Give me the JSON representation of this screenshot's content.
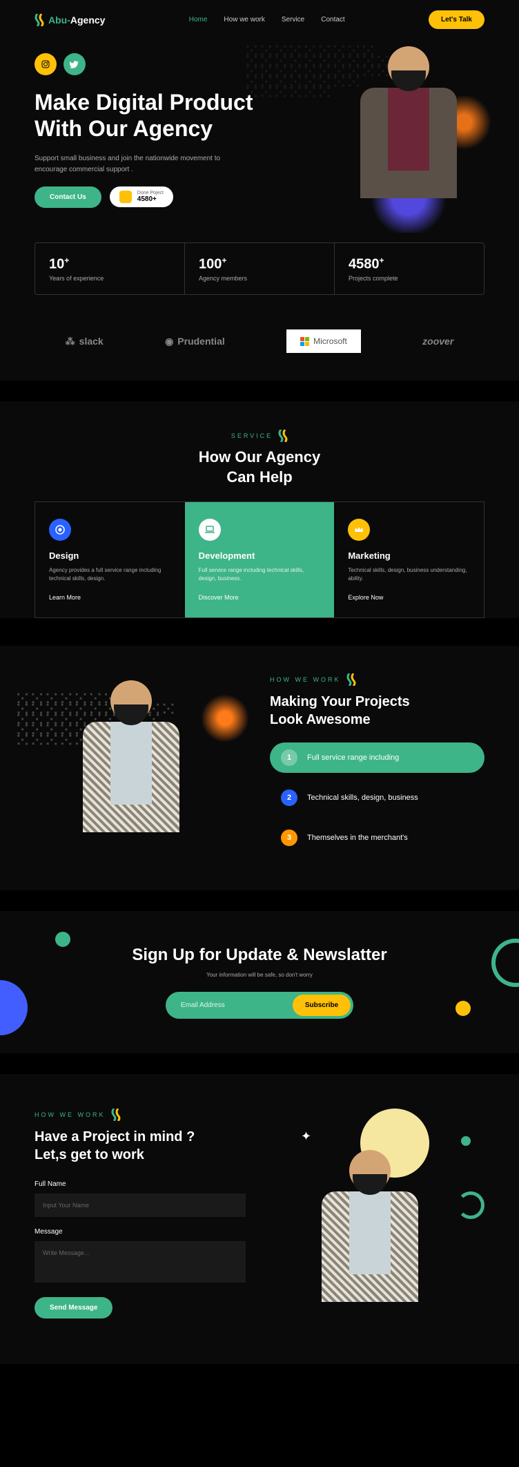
{
  "brand": {
    "abu": "Abu-",
    "agency": "Agency"
  },
  "nav": {
    "home": "Home",
    "how": "How we work",
    "service": "Service",
    "contact": "Contact"
  },
  "cta": "Let's Talk",
  "hero": {
    "title1": "Make Digital Product",
    "title2": "With Our Agency",
    "text": "Support small business and join the nationwide movement to encourage commercial support .",
    "contact": "Contact Us",
    "done_label": "Done Poject",
    "done_num": "4580+"
  },
  "stats": [
    {
      "num": "10",
      "plus": "+",
      "label": "Years of experience"
    },
    {
      "num": "100",
      "plus": "+",
      "label": "Agency members"
    },
    {
      "num": "4580",
      "plus": "+",
      "label": "Projects complete"
    }
  ],
  "logos": {
    "slack": "slack",
    "prudential": "Prudential",
    "microsoft": "Microsoft",
    "zoover": "zoover"
  },
  "services": {
    "label": "SERVICE",
    "title1": "How Our Agency",
    "title2": "Can Help",
    "cards": [
      {
        "name": "Design",
        "desc": "Agency provides a full service range including technical skills, design.",
        "link": "Learn More"
      },
      {
        "name": "Development",
        "desc": "Full service range including technical skills, design, business.",
        "link": "Discover More"
      },
      {
        "name": "Marketing",
        "desc": "Technical skills, design, business understanding, ability.",
        "link": "Explore Now"
      }
    ]
  },
  "how": {
    "label": "HOW WE WORK",
    "title1": "Making Your Projects",
    "title2": "Look Awesome",
    "steps": [
      {
        "num": "1",
        "text": "Full service range including"
      },
      {
        "num": "2",
        "text": "Technical skills, design, business"
      },
      {
        "num": "3",
        "text": "Themselves in the merchant's"
      }
    ]
  },
  "newsletter": {
    "title": "Sign Up for Update & Newslatter",
    "sub": "Your information will be safe, so don't worry",
    "placeholder": "Email Address",
    "btn": "Subscribe"
  },
  "contact": {
    "label": "HOW WE WORK",
    "title1": "Have a Project in mind ?",
    "title2": "Let,s get to work",
    "name_label": "Full Name",
    "name_ph": "Input Your Name",
    "msg_label": "Message",
    "msg_ph": "Write Message...",
    "btn": "Send Message"
  }
}
